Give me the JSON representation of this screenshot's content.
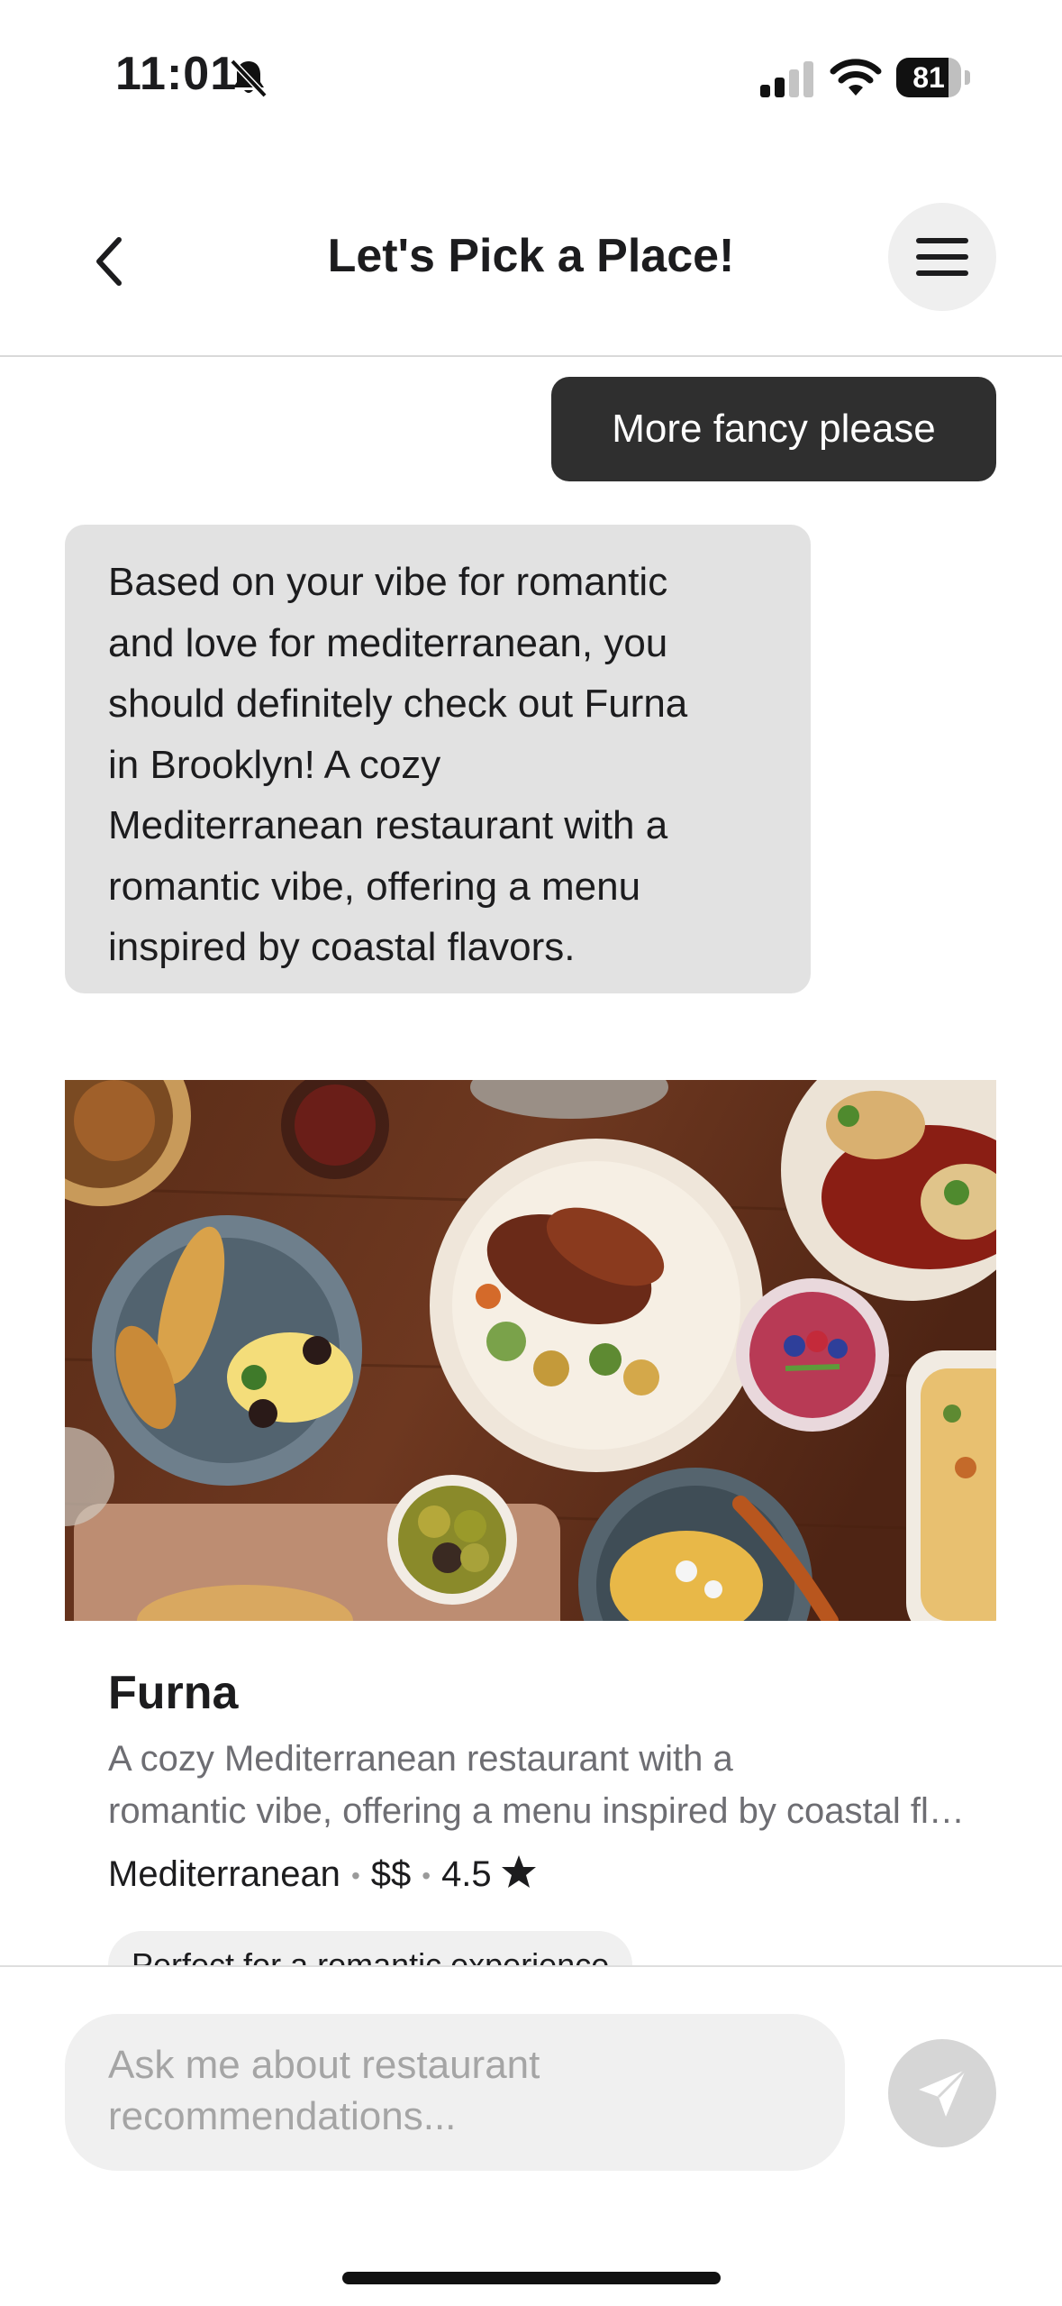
{
  "status_bar": {
    "time": "11:01",
    "battery": "81",
    "battery_level": 0.81
  },
  "header": {
    "title": "Let's Pick a Place!"
  },
  "chat": {
    "user_message": "More fancy please",
    "bot_lines": [
      "Based on your vibe for romantic",
      "and love for mediterranean, you",
      "should definitely check out Furna",
      "in Brooklyn! A cozy",
      "Mediterranean restaurant with a",
      "romantic vibe, offering a menu",
      "inspired by coastal flavors."
    ]
  },
  "restaurant_card": {
    "name": "Furna",
    "description_line1": "A cozy Mediterranean restaurant with a",
    "description_line2": "romantic vibe, offering a menu inspired by coastal flavors.",
    "cuisine": "Mediterranean",
    "price": "$$",
    "rating": "4.5",
    "separator": "•",
    "tag": "Perfect for a romantic experience",
    "image_icon": "food-spread-photo"
  },
  "input": {
    "placeholder_line1": "Ask me about restaurant",
    "placeholder_line2": "recommendations..."
  },
  "icons": {
    "back": "chevron-left-icon",
    "menu": "hamburger-menu-icon",
    "send": "paper-plane-icon",
    "star": "star-icon"
  },
  "colors": {
    "user_bubble": "#2f2f2f",
    "bot_bubble": "#e2e2e2",
    "muted_text": "#6e6e73",
    "send_button": "#d6d6d6"
  }
}
